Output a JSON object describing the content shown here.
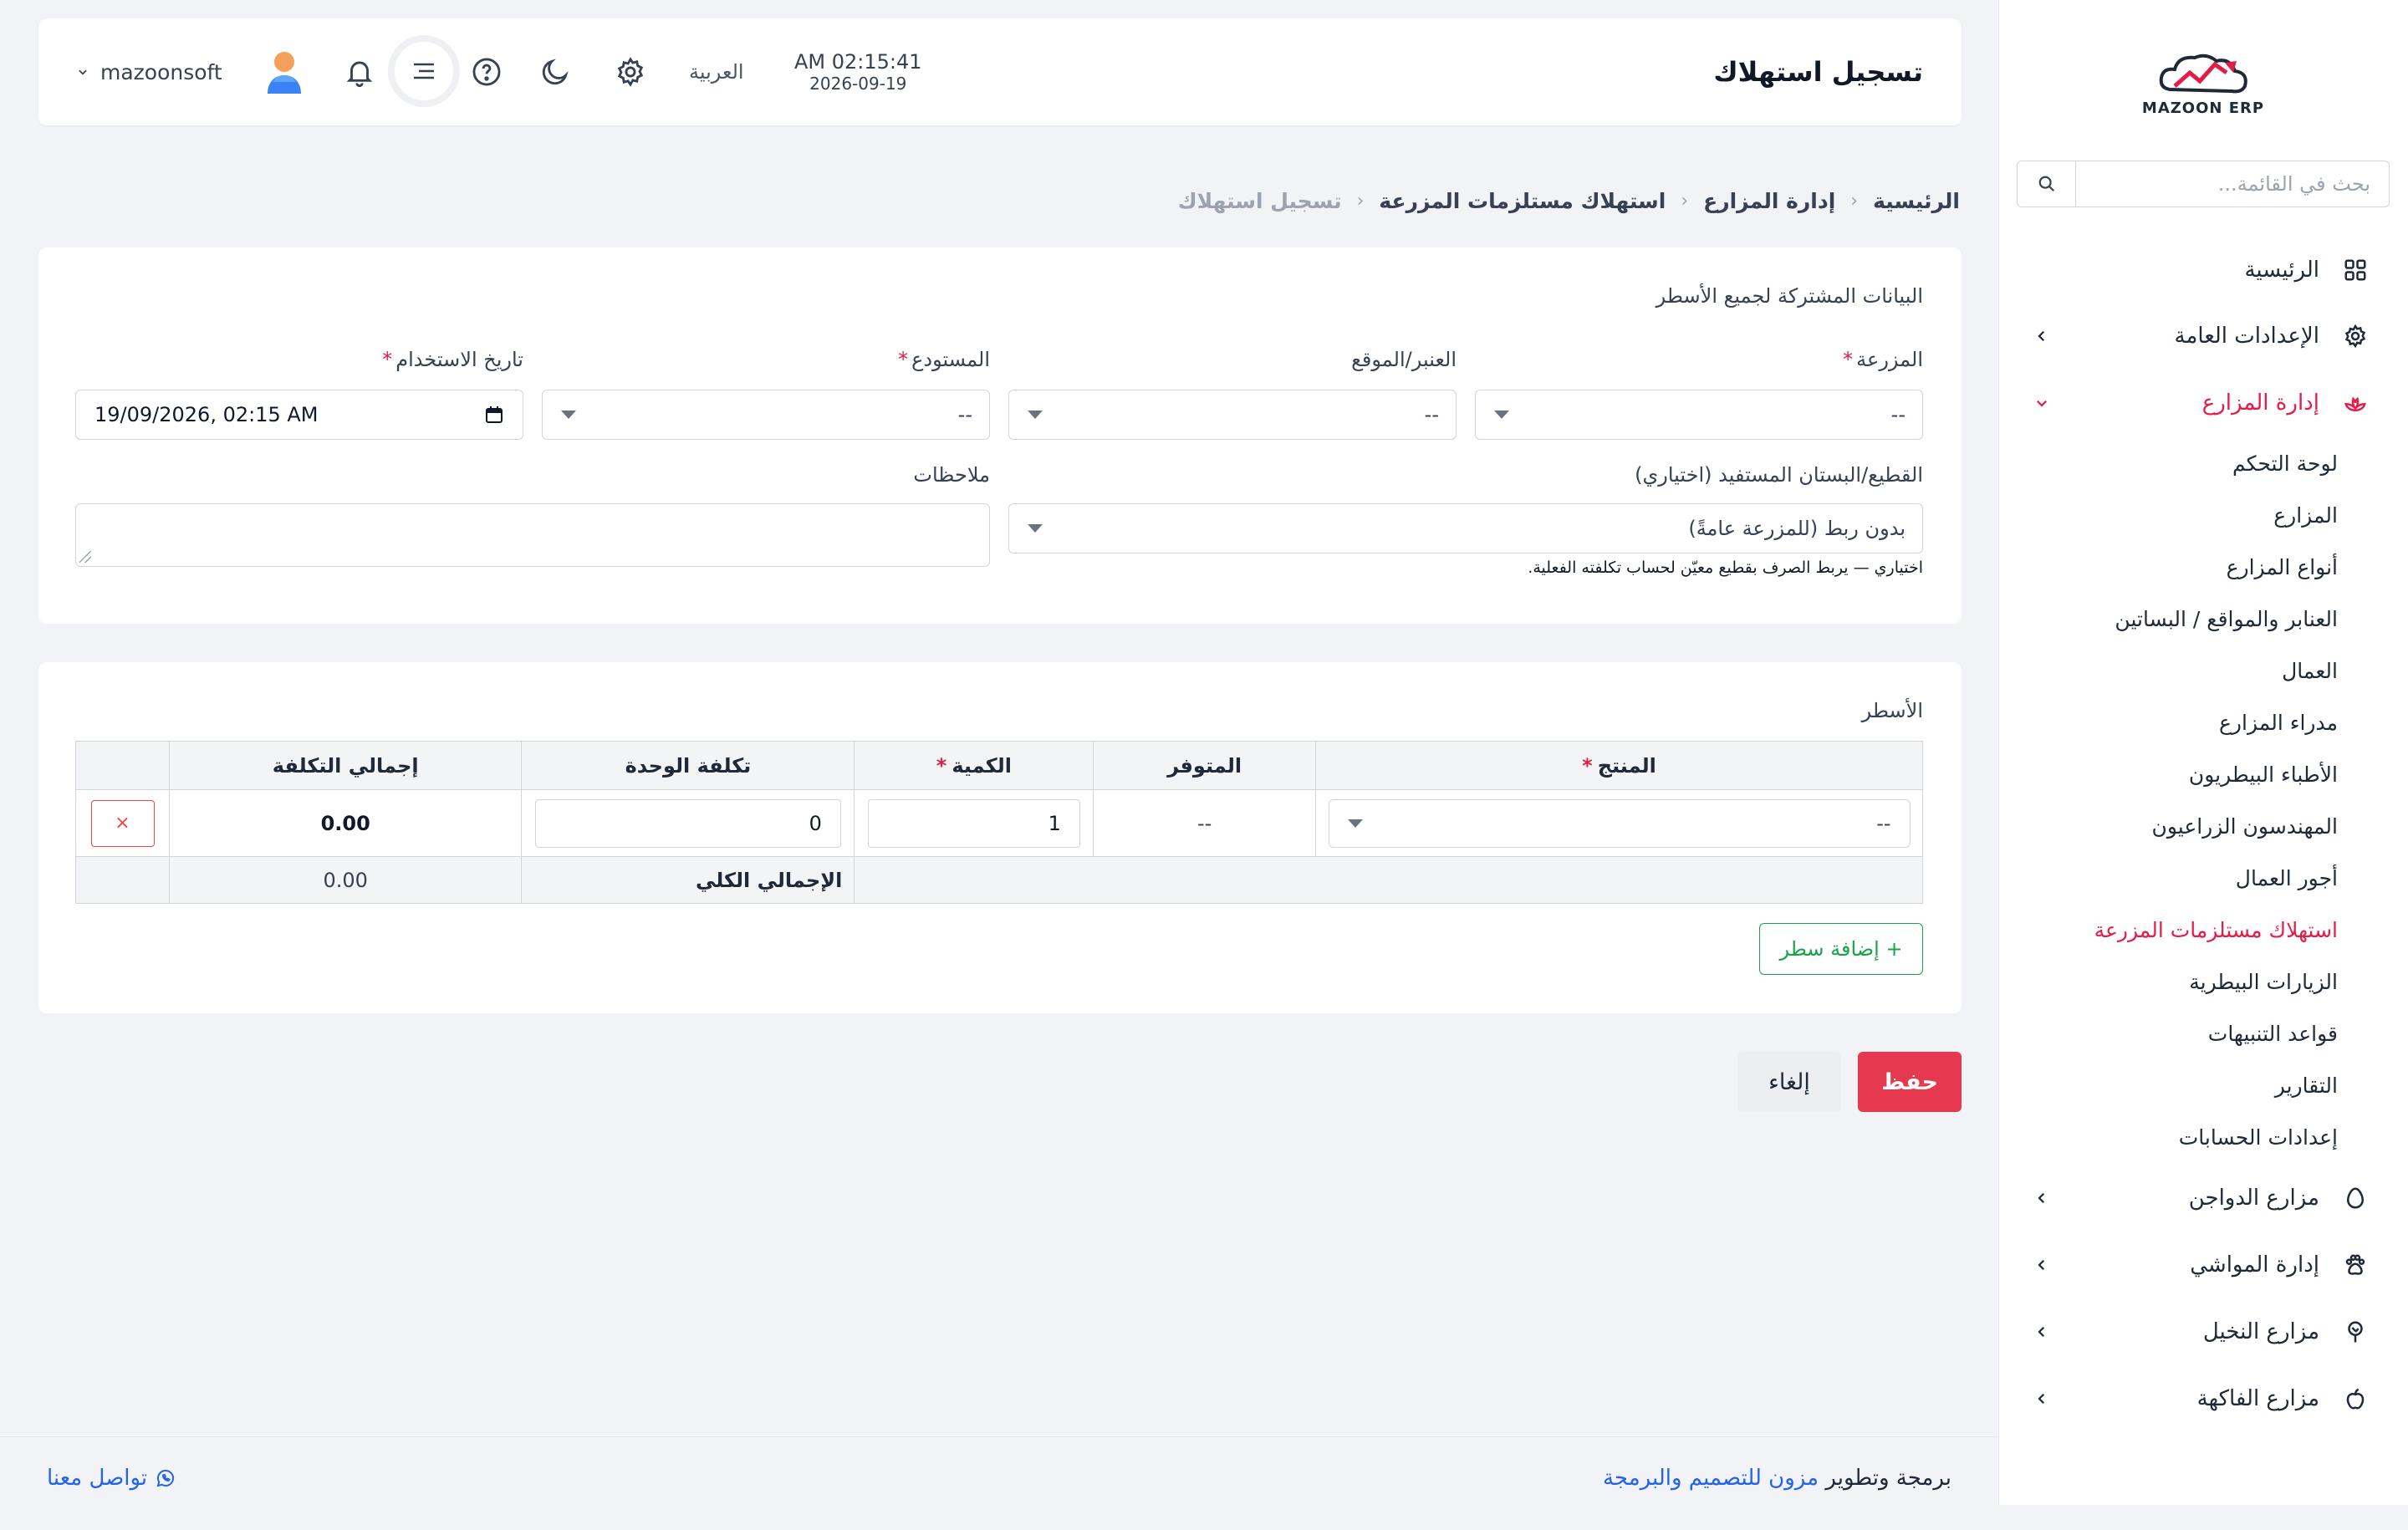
{
  "sidebar": {
    "logo_text": "MAZOON ERP",
    "search_placeholder": "بحث في القائمة...",
    "items": [
      {
        "label": "الرئيسية",
        "icon": "grid-icon",
        "expandable": false
      },
      {
        "label": "الإعدادات العامة",
        "icon": "gear-icon",
        "expandable": true
      },
      {
        "label": "إدارة المزارع",
        "icon": "lotus-icon",
        "expandable": true,
        "active": true
      },
      {
        "label": "مزارع الدواجن",
        "icon": "egg-icon",
        "expandable": true
      },
      {
        "label": "إدارة المواشي",
        "icon": "paw-icon",
        "expandable": true
      },
      {
        "label": "مزارع النخيل",
        "icon": "tree-icon",
        "expandable": true
      },
      {
        "label": "مزارع الفاكهة",
        "icon": "apple-icon",
        "expandable": true
      }
    ],
    "sub_items": [
      "لوحة التحكم",
      "المزارع",
      "أنواع المزارع",
      "العنابر والمواقع / البساتين",
      "العمال",
      "مدراء المزارع",
      "الأطباء البيطريون",
      "المهندسون الزراعيون",
      "أجور العمال",
      "استهلاك مستلزمات المزرعة",
      "الزيارات البيطرية",
      "قواعد التنبيهات",
      "التقارير",
      "إعدادات الحسابات"
    ],
    "active_sub_index": 9
  },
  "header": {
    "title": "تسجيل استهلاك",
    "time": "AM 02:15:41",
    "date": "2026-09-19",
    "language": "العربية",
    "username": "mazoonsoft"
  },
  "breadcrumb": {
    "items": [
      "الرئيسية",
      "إدارة المزارع",
      "استهلاك مستلزمات المزرعة"
    ],
    "current": "تسجيل استهلاك"
  },
  "shared": {
    "title": "البيانات المشتركة لجميع الأسطر",
    "farm_label": "المزرعة",
    "farm_value": "--",
    "barn_label": "العنبر/الموقع",
    "barn_value": "--",
    "warehouse_label": "المستودع",
    "warehouse_value": "--",
    "date_label": "تاريخ الاستخدام",
    "date_value": "19/09/2026, 02:15 AM",
    "plot_label": "القطيع/البستان المستفيد (اختياري)",
    "plot_value": "بدون ربط (للمزرعة عامةً)",
    "plot_hint": "اختياري — يربط الصرف بقطيع معيّن لحساب تكلفته الفعلية.",
    "notes_label": "ملاحظات"
  },
  "lines": {
    "title": "الأسطر",
    "columns": {
      "product": "المنتج",
      "available": "المتوفر",
      "quantity": "الكمية",
      "unit_cost": "تكلفة الوحدة",
      "total_cost": "إجمالي التكلفة"
    },
    "rows": [
      {
        "product": "--",
        "available": "--",
        "quantity": "1",
        "unit_cost": "0",
        "total_cost": "0.00"
      }
    ],
    "grand_total_label": "الإجمالي الكلي",
    "grand_total_value": "0.00",
    "remove_symbol": "×",
    "add_row_label": "+ إضافة سطر"
  },
  "actions": {
    "save_label": "حفظ",
    "cancel_label": "إلغاء"
  },
  "footer": {
    "credit_prefix": "برمجة وتطوير",
    "credit_link": "مزون للتصميم والبرمجة",
    "contact_label": "تواصل معنا"
  },
  "colors": {
    "accent": "#e11d48",
    "save": "#e5394f",
    "add_row": "#16a34a",
    "link": "#2563eb"
  }
}
